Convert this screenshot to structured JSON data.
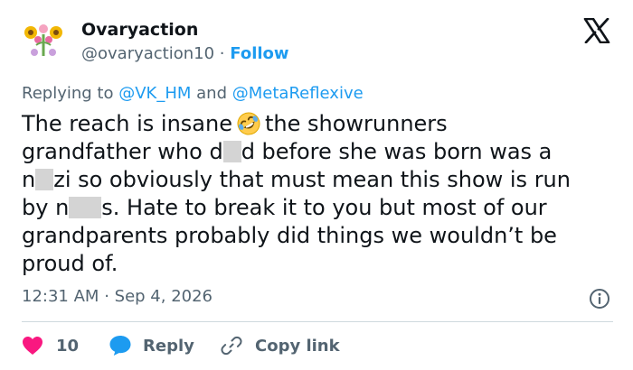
{
  "author": {
    "name": "Ovaryaction",
    "handle": "@ovaryaction10",
    "separator": "·",
    "follow_label": "Follow"
  },
  "reply_context": {
    "prefix": "Replying to",
    "mention_1": "@VK_HM",
    "conjunction": "and",
    "mention_2": "@MetaReflexive"
  },
  "tweet": {
    "line1_a": "The reach is insane",
    "line1_b": "the showrunners",
    "line2_a": "grandfather who d",
    "line2_b": "d before she was born was a",
    "line3_a": "n",
    "line3_b": "zi so obviously that must mean this show is run",
    "line4_a": "by n",
    "line4_b": "s. Hate to break it to you but most of our",
    "line5": "grandparents probably did things we wouldn’t be",
    "line6": "proud of.",
    "emoji": "rolling-on-floor-laughing-emoji"
  },
  "meta": {
    "time": "12:31 AM",
    "separator": "·",
    "date": "Sep 4, 2026"
  },
  "actions": {
    "like_count": "10",
    "reply_label": "Reply",
    "copy_link_label": "Copy link"
  },
  "colors": {
    "accent": "#1d9bf0",
    "secondary_text": "#536471",
    "like": "#f91880",
    "divider": "#cfd9de"
  },
  "icons": [
    "avatar-flowers",
    "x-logo-icon",
    "info-icon",
    "heart-icon",
    "reply-bubble-icon",
    "link-icon"
  ]
}
